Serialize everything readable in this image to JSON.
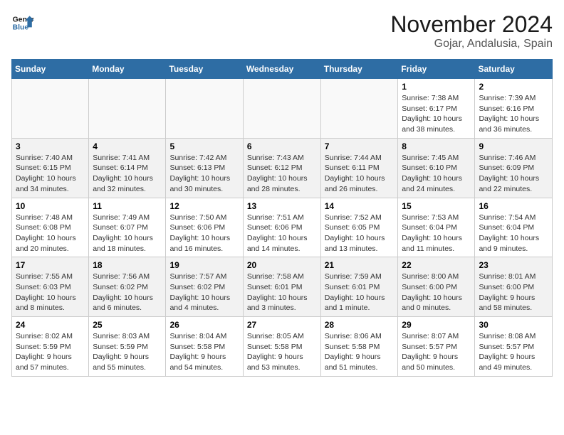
{
  "header": {
    "logo_line1": "General",
    "logo_line2": "Blue",
    "month": "November 2024",
    "location": "Gojar, Andalusia, Spain"
  },
  "weekdays": [
    "Sunday",
    "Monday",
    "Tuesday",
    "Wednesday",
    "Thursday",
    "Friday",
    "Saturday"
  ],
  "weeks": [
    [
      {
        "day": "",
        "info": ""
      },
      {
        "day": "",
        "info": ""
      },
      {
        "day": "",
        "info": ""
      },
      {
        "day": "",
        "info": ""
      },
      {
        "day": "",
        "info": ""
      },
      {
        "day": "1",
        "info": "Sunrise: 7:38 AM\nSunset: 6:17 PM\nDaylight: 10 hours and 38 minutes."
      },
      {
        "day": "2",
        "info": "Sunrise: 7:39 AM\nSunset: 6:16 PM\nDaylight: 10 hours and 36 minutes."
      }
    ],
    [
      {
        "day": "3",
        "info": "Sunrise: 7:40 AM\nSunset: 6:15 PM\nDaylight: 10 hours and 34 minutes."
      },
      {
        "day": "4",
        "info": "Sunrise: 7:41 AM\nSunset: 6:14 PM\nDaylight: 10 hours and 32 minutes."
      },
      {
        "day": "5",
        "info": "Sunrise: 7:42 AM\nSunset: 6:13 PM\nDaylight: 10 hours and 30 minutes."
      },
      {
        "day": "6",
        "info": "Sunrise: 7:43 AM\nSunset: 6:12 PM\nDaylight: 10 hours and 28 minutes."
      },
      {
        "day": "7",
        "info": "Sunrise: 7:44 AM\nSunset: 6:11 PM\nDaylight: 10 hours and 26 minutes."
      },
      {
        "day": "8",
        "info": "Sunrise: 7:45 AM\nSunset: 6:10 PM\nDaylight: 10 hours and 24 minutes."
      },
      {
        "day": "9",
        "info": "Sunrise: 7:46 AM\nSunset: 6:09 PM\nDaylight: 10 hours and 22 minutes."
      }
    ],
    [
      {
        "day": "10",
        "info": "Sunrise: 7:48 AM\nSunset: 6:08 PM\nDaylight: 10 hours and 20 minutes."
      },
      {
        "day": "11",
        "info": "Sunrise: 7:49 AM\nSunset: 6:07 PM\nDaylight: 10 hours and 18 minutes."
      },
      {
        "day": "12",
        "info": "Sunrise: 7:50 AM\nSunset: 6:06 PM\nDaylight: 10 hours and 16 minutes."
      },
      {
        "day": "13",
        "info": "Sunrise: 7:51 AM\nSunset: 6:06 PM\nDaylight: 10 hours and 14 minutes."
      },
      {
        "day": "14",
        "info": "Sunrise: 7:52 AM\nSunset: 6:05 PM\nDaylight: 10 hours and 13 minutes."
      },
      {
        "day": "15",
        "info": "Sunrise: 7:53 AM\nSunset: 6:04 PM\nDaylight: 10 hours and 11 minutes."
      },
      {
        "day": "16",
        "info": "Sunrise: 7:54 AM\nSunset: 6:04 PM\nDaylight: 10 hours and 9 minutes."
      }
    ],
    [
      {
        "day": "17",
        "info": "Sunrise: 7:55 AM\nSunset: 6:03 PM\nDaylight: 10 hours and 8 minutes."
      },
      {
        "day": "18",
        "info": "Sunrise: 7:56 AM\nSunset: 6:02 PM\nDaylight: 10 hours and 6 minutes."
      },
      {
        "day": "19",
        "info": "Sunrise: 7:57 AM\nSunset: 6:02 PM\nDaylight: 10 hours and 4 minutes."
      },
      {
        "day": "20",
        "info": "Sunrise: 7:58 AM\nSunset: 6:01 PM\nDaylight: 10 hours and 3 minutes."
      },
      {
        "day": "21",
        "info": "Sunrise: 7:59 AM\nSunset: 6:01 PM\nDaylight: 10 hours and 1 minute."
      },
      {
        "day": "22",
        "info": "Sunrise: 8:00 AM\nSunset: 6:00 PM\nDaylight: 10 hours and 0 minutes."
      },
      {
        "day": "23",
        "info": "Sunrise: 8:01 AM\nSunset: 6:00 PM\nDaylight: 9 hours and 58 minutes."
      }
    ],
    [
      {
        "day": "24",
        "info": "Sunrise: 8:02 AM\nSunset: 5:59 PM\nDaylight: 9 hours and 57 minutes."
      },
      {
        "day": "25",
        "info": "Sunrise: 8:03 AM\nSunset: 5:59 PM\nDaylight: 9 hours and 55 minutes."
      },
      {
        "day": "26",
        "info": "Sunrise: 8:04 AM\nSunset: 5:58 PM\nDaylight: 9 hours and 54 minutes."
      },
      {
        "day": "27",
        "info": "Sunrise: 8:05 AM\nSunset: 5:58 PM\nDaylight: 9 hours and 53 minutes."
      },
      {
        "day": "28",
        "info": "Sunrise: 8:06 AM\nSunset: 5:58 PM\nDaylight: 9 hours and 51 minutes."
      },
      {
        "day": "29",
        "info": "Sunrise: 8:07 AM\nSunset: 5:57 PM\nDaylight: 9 hours and 50 minutes."
      },
      {
        "day": "30",
        "info": "Sunrise: 8:08 AM\nSunset: 5:57 PM\nDaylight: 9 hours and 49 minutes."
      }
    ]
  ]
}
